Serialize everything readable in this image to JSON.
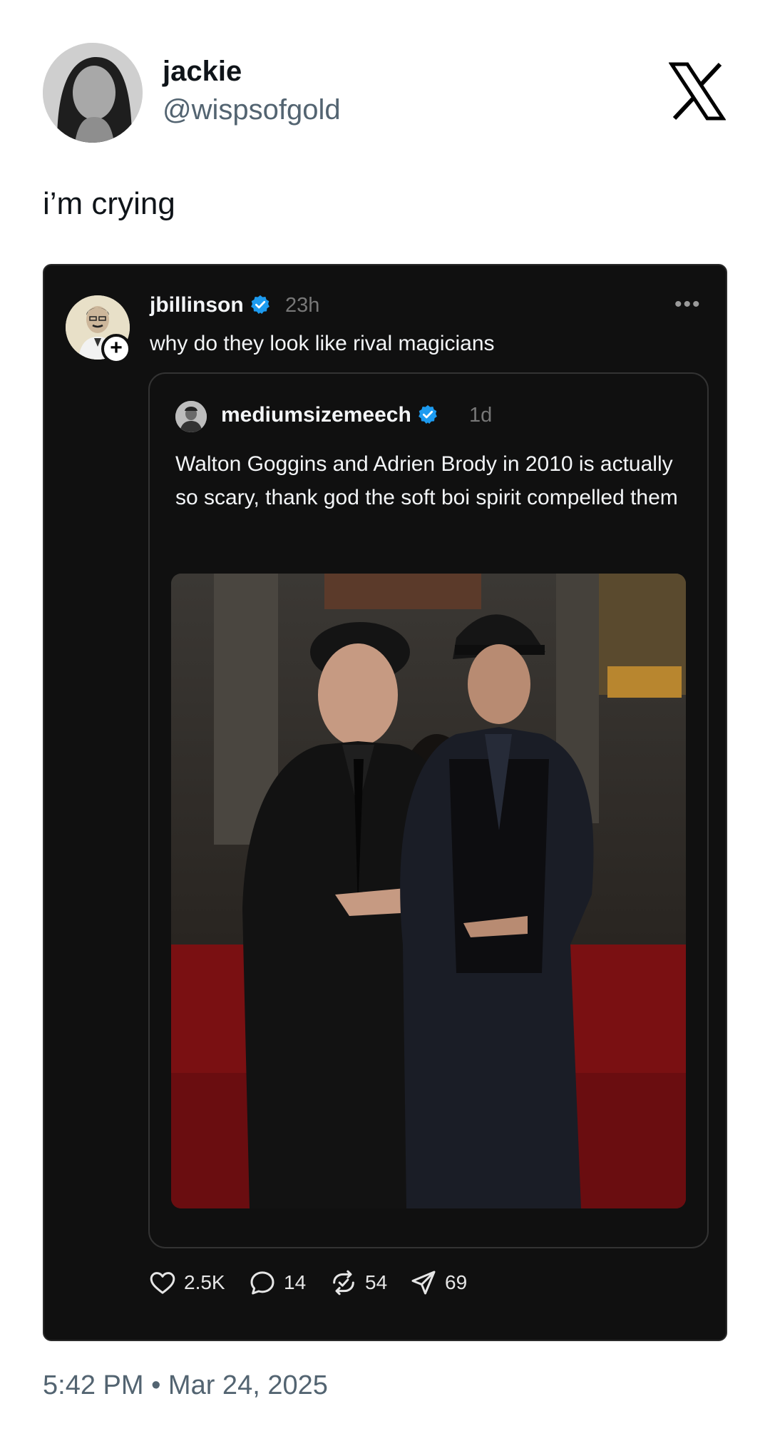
{
  "author": {
    "display_name": "jackie",
    "handle": "@wispsofgold",
    "avatar_icon": "profile-photo-icon"
  },
  "tweet": {
    "text": "i’m crying",
    "timestamp": "5:42 PM • Mar 24, 2025"
  },
  "platform_logo": "x-logo-icon",
  "embedded_post": {
    "username": "jbillinson",
    "time": "23h",
    "more_label": "•••",
    "follow_label": "+",
    "text": "why do they look like rival magicians",
    "quoted": {
      "username": "mediumsizemeech",
      "time": "1d",
      "text": "Walton Goggins and Adrien Brody in 2010 is actually so scary, thank god the soft boi spirit compelled them"
    },
    "actions": {
      "likes": "2.5K",
      "replies": "14",
      "reposts": "54",
      "shares": "69"
    }
  },
  "colors": {
    "embed_bg": "#101010",
    "verified_blue": "#1d9bf0",
    "muted_text": "#536471"
  }
}
